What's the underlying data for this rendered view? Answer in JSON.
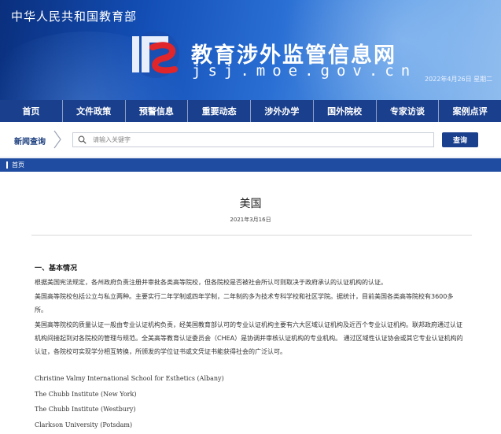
{
  "header": {
    "ministry": "中华人民共和国教育部",
    "site_title": "教育涉外监管信息网",
    "site_domain": "jsj.moe.gov.cn",
    "date": "2022年4月26日 星期二"
  },
  "nav": {
    "items": [
      "首页",
      "文件政策",
      "预警信息",
      "重要动态",
      "涉外办学",
      "国外院校",
      "专家访谈",
      "案例点评"
    ]
  },
  "search": {
    "label": "新闻查询",
    "placeholder": "请输入关键字",
    "button": "查询"
  },
  "breadcrumb": {
    "home": "首页"
  },
  "article": {
    "title": "美国",
    "date": "2021年3月16日",
    "section_title": "一、基本情况",
    "paragraphs": [
      "根据美国宪法规定，各州政府负责注册并审批各类高等院校，但各院校是否被社会所认可则取决于政府承认的认证机构的认证。",
      "美国高等院校包括公立与私立两种。主要实行二年学制或四年学制，二年制的多为技术专科学校和社区学院。据统计，目前美国各类高等院校有3600多所。",
      "美国高等院校的质量认证一般由专业认证机构负责，经美国教育部认可的专业认证机构主要有六大区域认证机构及近百个专业认证机构。联邦政府通过认证机构间接起到对各院校的管理与规范。全美高等教育认证委员会（CHEA）是协调并审核认证机构的专业机构。 通过区域性认证协会或其它专业认证机构的认证，各院校可实现学分相互转换，所颁发的学位证书或文凭证书能获得社会的广泛认可。"
    ],
    "schools": [
      "Christine Valmy International School for Esthetics (Albany)",
      "The Chubb Institute (New York)",
      "The Chubb Institute (Westbury)",
      "Clarkson University (Potsdam)"
    ]
  },
  "colors": {
    "nav_bg": "#1a3f8c",
    "breadcrumb_bg": "#1f4ca0",
    "logo_red": "#e0262b"
  },
  "icons": {
    "logo": "moe-logo-icon",
    "search": "search-icon",
    "chevron": "chevron-right-icon"
  }
}
